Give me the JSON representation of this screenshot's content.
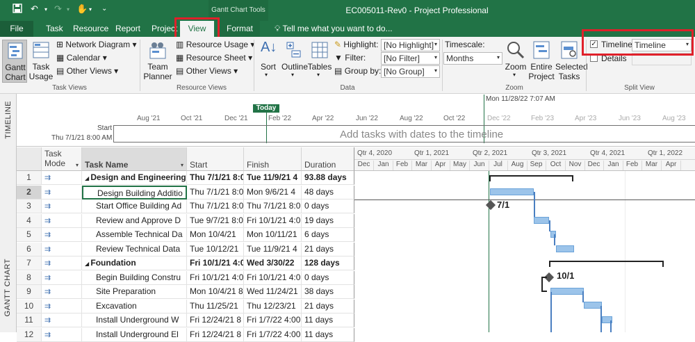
{
  "titlebar": {
    "contextual_label": "Gantt Chart Tools",
    "doc_title": "EC005011-Rev0 - Project Professional"
  },
  "tabs": {
    "file": "File",
    "task": "Task",
    "resource": "Resource",
    "report": "Report",
    "project": "Project",
    "view": "View",
    "format": "Format",
    "tellme": "Tell me what you want to do..."
  },
  "ribbon": {
    "gantt_chart": [
      "Gantt",
      "Chart"
    ],
    "task_usage": [
      "Task",
      "Usage"
    ],
    "network_diagram": "Network Diagram",
    "calendar": "Calendar",
    "other_views_1": "Other Views",
    "task_views_label": "Task Views",
    "team_planner": [
      "Team",
      "Planner"
    ],
    "resource_usage": "Resource Usage",
    "resource_sheet": "Resource Sheet",
    "other_views_2": "Other Views",
    "resource_views_label": "Resource Views",
    "sort": "Sort",
    "outline": "Outline",
    "tables": "Tables",
    "highlight_label": "Highlight:",
    "highlight_value": "[No Highlight]",
    "filter_label": "Filter:",
    "filter_value": "[No Filter]",
    "groupby_label": "Group by:",
    "groupby_value": "[No Group]",
    "data_label": "Data",
    "timescale_label": "Timescale:",
    "timescale_value": "Months",
    "zoom": "Zoom",
    "entire_project": [
      "Entire",
      "Project"
    ],
    "selected_tasks": [
      "Selected",
      "Tasks"
    ],
    "zoom_label": "Zoom",
    "timeline_check": "Timeline",
    "timeline_value": "Timeline",
    "details_check": "Details",
    "split_view_label": "Split View"
  },
  "timeline": {
    "side_label": "TIMELINE",
    "today_label": "Today",
    "date_marker": "Mon 11/28/22 7:07 AM",
    "months": [
      "Aug '21",
      "Oct '21",
      "Dec '21",
      "Feb '22",
      "Apr '22",
      "Jun '22",
      "Aug '22",
      "Oct '22",
      "Dec '22",
      "Feb '23",
      "Apr '23",
      "Jun '23",
      "Aug '23"
    ],
    "start_label": "Start",
    "start_date": "Thu 7/1/21 8:00 AM",
    "empty_msg": "Add tasks with dates to the timeline"
  },
  "gantt": {
    "side_label": "GANTT CHART",
    "headers": {
      "mode": [
        "Task",
        "Mode"
      ],
      "name": "Task Name",
      "start": "Start",
      "finish": "Finish",
      "duration": "Duration"
    },
    "quarters": [
      "Qtr 4, 2020",
      "Qtr 1, 2021",
      "Qtr 2, 2021",
      "Qtr 3, 2021",
      "Qtr 4, 2021",
      "Qtr 1, 2022"
    ],
    "months": [
      "Dec",
      "Jan",
      "Feb",
      "Mar",
      "Apr",
      "May",
      "Jun",
      "Jul",
      "Aug",
      "Sep",
      "Oct",
      "Nov",
      "Dec",
      "Jan",
      "Feb",
      "Mar",
      "Apr"
    ],
    "rows": [
      {
        "id": "1",
        "name": "Design and Engineering",
        "start": "Thu 7/1/21 8:0",
        "finish": "Tue 11/9/21 4",
        "duration": "93.88 days",
        "summary": true
      },
      {
        "id": "2",
        "name": "Design Building Additio",
        "start": "Thu 7/1/21 8:0",
        "finish": "Mon 9/6/21 4",
        "duration": "48 days",
        "summary": false
      },
      {
        "id": "3",
        "name": "Start Office Building Ad",
        "start": "Thu 7/1/21 8:0",
        "finish": "Thu 7/1/21 8:0",
        "duration": "0 days",
        "summary": false
      },
      {
        "id": "4",
        "name": "Review and Approve D",
        "start": "Tue 9/7/21 8:0",
        "finish": "Fri 10/1/21 4:0",
        "duration": "19 days",
        "summary": false
      },
      {
        "id": "5",
        "name": "Assemble Technical Da",
        "start": "Mon 10/4/21",
        "finish": "Mon 10/11/21",
        "duration": "6 days",
        "summary": false
      },
      {
        "id": "6",
        "name": "Review Technical Data",
        "start": "Tue 10/12/21",
        "finish": "Tue 11/9/21 4",
        "duration": "21 days",
        "summary": false
      },
      {
        "id": "7",
        "name": "Foundation",
        "start": "Fri 10/1/21 4:0",
        "finish": "Wed 3/30/22",
        "duration": "128 days",
        "summary": true
      },
      {
        "id": "8",
        "name": "Begin Building Constru",
        "start": "Fri 10/1/21 4:0",
        "finish": "Fri 10/1/21 4:0",
        "duration": "0 days",
        "summary": false
      },
      {
        "id": "9",
        "name": "Site Preparation",
        "start": "Mon 10/4/21 8",
        "finish": "Wed 11/24/21",
        "duration": "38 days",
        "summary": false
      },
      {
        "id": "10",
        "name": "Excavation",
        "start": "Thu 11/25/21",
        "finish": "Thu 12/23/21",
        "duration": "21 days",
        "summary": false
      },
      {
        "id": "11",
        "name": "Install Underground W",
        "start": "Fri 12/24/21 8",
        "finish": "Fri 1/7/22 4:00",
        "duration": "11 days",
        "summary": false
      },
      {
        "id": "12",
        "name": "Install Underground El",
        "start": "Fri 12/24/21 8",
        "finish": "Fri 1/7/22 4:00",
        "duration": "11 days",
        "summary": false
      }
    ],
    "milestones": [
      "7/1",
      "10/1"
    ]
  }
}
